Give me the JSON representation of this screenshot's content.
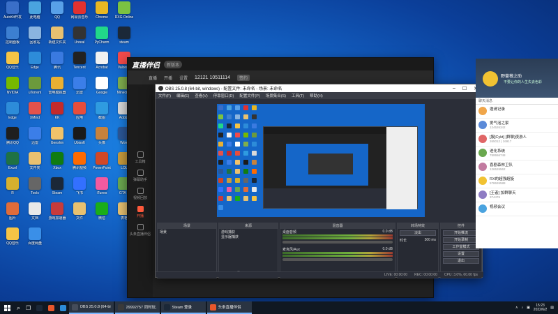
{
  "desktop": {
    "icons": [
      {
        "label": "AutoKit开发",
        "color": "#3a6fc8"
      },
      {
        "label": "此电脑",
        "color": "#4aa3df"
      },
      {
        "label": "QQ",
        "color": "#58a0e8"
      },
      {
        "label": "网易云音乐",
        "color": "#e2312f"
      },
      {
        "label": "Chrome",
        "color": "#e8b723"
      },
      {
        "label": "RXG Online",
        "color": "#7bc241"
      },
      {
        "label": "控制面板",
        "color": "#3c7fd1"
      },
      {
        "label": "回收站",
        "color": "#8ab4e0"
      },
      {
        "label": "新建文件夹",
        "color": "#e8c170"
      },
      {
        "label": "Unreal",
        "color": "#333333"
      },
      {
        "label": "PyCharm",
        "color": "#21d789"
      },
      {
        "label": "steam",
        "color": "#1b2838"
      },
      {
        "label": "QQ音乐",
        "color": "#f5c445"
      },
      {
        "label": "Edge",
        "color": "#2d8cd9"
      },
      {
        "label": "腾讯",
        "color": "#3a7ae0"
      },
      {
        "label": "Tencent",
        "color": "#222222"
      },
      {
        "label": "Acrobat",
        "color": "#f1f1f1"
      },
      {
        "label": "Valorant",
        "color": "#f24a4a"
      },
      {
        "label": "NVIDIA",
        "color": "#76b900"
      },
      {
        "label": "uTorrent",
        "color": "#6c9a3c"
      },
      {
        "label": "雷电模拟器",
        "color": "#e9b032"
      },
      {
        "label": "迅雷",
        "color": "#3b7ee8"
      },
      {
        "label": "Google",
        "color": "#ffffff"
      },
      {
        "label": "Minecraft",
        "color": "#7fae4d"
      },
      {
        "label": "Edge",
        "color": "#2d8cd9"
      },
      {
        "label": "XMind",
        "color": "#e3524b"
      },
      {
        "label": "KK",
        "color": "#c42a2a"
      },
      {
        "label": "应用",
        "color": "#e74d3c"
      },
      {
        "label": "截图",
        "color": "#2f9be0"
      },
      {
        "label": "Adobe",
        "color": "#d9d9d9"
      },
      {
        "label": "腾讯QQ",
        "color": "#1f1f1f"
      },
      {
        "label": "迅雷",
        "color": "#3b7ee8"
      },
      {
        "label": "Genshin",
        "color": "#f0c36a"
      },
      {
        "label": "Ubisoft",
        "color": "#1a1a1a"
      },
      {
        "label": "头像",
        "color": "#c7823d"
      },
      {
        "label": "Word",
        "color": "#2b5797"
      },
      {
        "label": "Excel",
        "color": "#1f7244"
      },
      {
        "label": "文件夹",
        "color": "#e8c170"
      },
      {
        "label": "Xbox",
        "color": "#107c10"
      },
      {
        "label": "腾讯视频",
        "color": "#ff6a00"
      },
      {
        "label": "PowerPoint",
        "color": "#d24726"
      },
      {
        "label": "LOL",
        "color": "#c89b3c"
      },
      {
        "label": "R",
        "color": "#d6b02e"
      },
      {
        "label": "Tools",
        "color": "#666666"
      },
      {
        "label": "Steam",
        "color": "#1b2838"
      },
      {
        "label": "飞书",
        "color": "#3370ff"
      },
      {
        "label": "iTunes",
        "color": "#f25aa0"
      },
      {
        "label": "GTA V",
        "color": "#6aa84f"
      },
      {
        "label": "图片",
        "color": "#e06c3a"
      },
      {
        "label": "文档",
        "color": "#e8e8e8"
      },
      {
        "label": "游戏加速器",
        "color": "#c73b3b"
      },
      {
        "label": "文件",
        "color": "#e8c170"
      },
      {
        "label": "微信",
        "color": "#1aad19"
      },
      {
        "label": "表格",
        "color": "#e8c170"
      },
      {
        "label": "QQ音乐",
        "color": "#f5c445"
      },
      {
        "label": "百度网盘",
        "color": "#3a8fe8"
      }
    ]
  },
  "zhubo": {
    "logo": "直播伴侣",
    "version": "新版本",
    "room_id": "12121 10511114",
    "room_tag": "签约",
    "tabs": [
      "直播",
      "开播",
      "设置"
    ],
    "sidebar": [
      "工具箱",
      "弹幕助手",
      "视频回放",
      "试播"
    ],
    "active_item": "开播",
    "bottom": "头条直播伴侣"
  },
  "obs": {
    "title": "OBS 25.0.8 (64-bit, windows) - 配置文件: 未命名 - 场景: 未命名",
    "menu": [
      "文件(F)",
      "编辑(E)",
      "查看(V)",
      "停靠窗口(D)",
      "配置文件(P)",
      "场景集合(S)",
      "工具(T)",
      "帮助(H)"
    ],
    "docks": {
      "scenes": {
        "title": "场景",
        "items": [
          "场景"
        ]
      },
      "sources": {
        "title": "来源",
        "items": [
          "游戏捕获",
          "显示器捕获"
        ]
      },
      "mixer": {
        "title": "混音器",
        "tracks": [
          {
            "name": "桌面音频",
            "level": "0.0 dB"
          },
          {
            "name": "麦克风/Aux",
            "level": "0.0 dB"
          }
        ]
      },
      "transitions": {
        "title": "转场特效",
        "mode": "淡出",
        "duration_label": "时长",
        "duration": "300 ms"
      },
      "controls": {
        "title": "控件",
        "buttons": [
          "开始推流",
          "开始录制",
          "工作室模式",
          "设置",
          "退出"
        ]
      }
    },
    "status": {
      "live": "LIVE: 00:00:00",
      "rec": "REC: 00:00:00",
      "cpu": "CPU: 3.0%, 60.00 fps"
    }
  },
  "chat": {
    "header_name": "野蔷薇之助",
    "header_sign": "不要让你的人生失去色彩",
    "tab": "聊天消息",
    "rows": [
      {
        "name": "邀请记录",
        "sub": ""
      },
      {
        "name": "爱气泡之家",
        "sub": "124526342"
      },
      {
        "name": "[服]Cykt] [群聊]夜游人",
        "sub": "265012 | 16917"
      },
      {
        "name": "进化系统",
        "sub": "789556748"
      },
      {
        "name": "喜剧森林卫队",
        "sub": "126526562"
      },
      {
        "name": "RX的超强超旋",
        "sub": "578626588"
      },
      {
        "name": "[王者] 加群聊天",
        "sub": "374476"
      },
      {
        "name": "视频会议",
        "sub": ""
      }
    ]
  },
  "taskbar": {
    "apps": [
      {
        "label": "OBS 25.0.8 (64-bit)",
        "color": "#444c5a"
      },
      {
        "label": "29992757 同时玩...",
        "color": "#3a3a3a"
      },
      {
        "label": "Steam 登录",
        "color": "#1b2838"
      },
      {
        "label": "头条直播伴侣",
        "color": "#e9572b"
      }
    ],
    "time": "15:23",
    "date": "2022/6/2"
  }
}
